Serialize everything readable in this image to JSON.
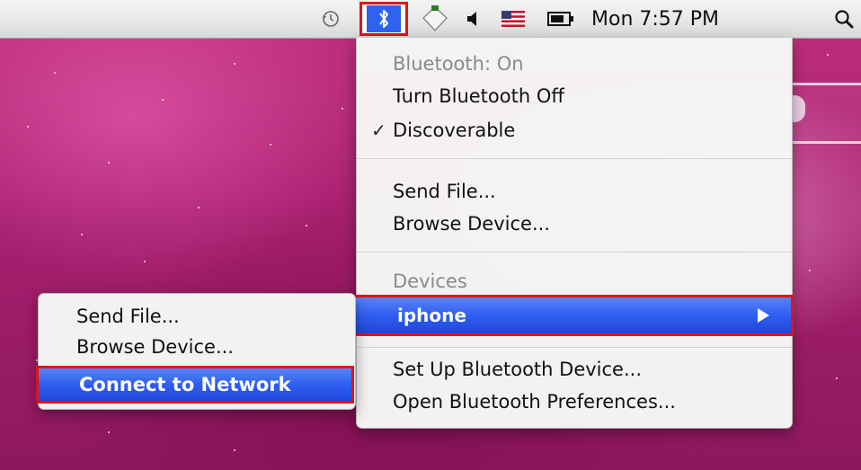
{
  "menubar": {
    "clock": "Mon 7:57 PM",
    "icons": [
      "time-machine-icon",
      "bluetooth-icon",
      "wifi-icon",
      "volume-icon",
      "us-flag-icon",
      "battery-icon",
      "spotlight-icon"
    ]
  },
  "bluetooth_menu": {
    "status": "Bluetooth: On",
    "toggle": "Turn Bluetooth Off",
    "discoverable": "Discoverable",
    "send_file": "Send File...",
    "browse_device": "Browse Device...",
    "devices_header": "Devices",
    "device_name": "iphone",
    "setup": "Set Up Bluetooth Device...",
    "preferences": "Open Bluetooth Preferences..."
  },
  "device_submenu": {
    "send_file": "Send File...",
    "browse_device": "Browse Device...",
    "connect_network": "Connect to Network"
  },
  "colors": {
    "highlight": "#2f5ef0",
    "annotation_outline": "#e0131a",
    "wallpaper": "#b0246f"
  }
}
